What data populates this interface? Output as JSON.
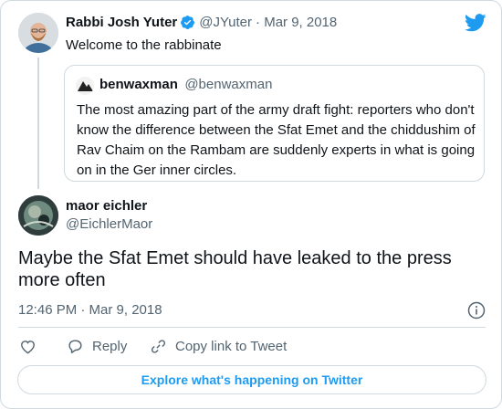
{
  "parent_tweet": {
    "author_name": "Rabbi Josh Yuter",
    "handle": "@JYuter",
    "date": "· Mar 9, 2018",
    "text": "Welcome to the rabbinate"
  },
  "quoted_tweet": {
    "author_name": "benwaxman",
    "handle": "@benwaxman",
    "text": "The most amazing part of the army draft fight: reporters who don't know the difference between the Sfat Emet and the chiddushim of Rav Chaim on the Rambam are suddenly experts in what is going on in the Ger inner circles."
  },
  "reply_tweet": {
    "author_name": "maor eichler",
    "handle": "@EichlerMaor",
    "text": "Maybe the Sfat Emet should have leaked to the press more often",
    "timestamp": "12:46 PM · Mar 9, 2018"
  },
  "actions": {
    "reply_label": "Reply",
    "copy_link_label": "Copy link to Tweet"
  },
  "explore_label": "Explore what's happening on Twitter",
  "colors": {
    "accent": "#1d9bf0",
    "verified": "#1d9bf0",
    "text": "#0f1419",
    "muted": "#536471",
    "border": "#cfd9de"
  },
  "icons": [
    "twitter-bird-icon",
    "verified-badge-icon",
    "info-icon",
    "heart-icon",
    "reply-icon",
    "link-icon"
  ]
}
